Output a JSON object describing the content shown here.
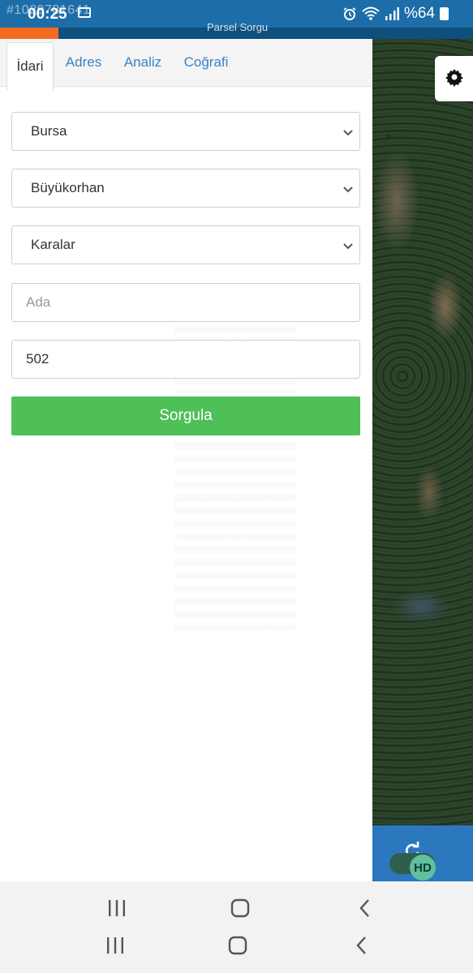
{
  "status_bar": {
    "watermark_id": "#1029781641",
    "time": "00:25",
    "battery": "%64",
    "icons": [
      "image-icon",
      "alarm-icon",
      "wifi-icon",
      "signal-icon",
      "battery-icon"
    ]
  },
  "app": {
    "accent_color": "#f26b21",
    "header_color": "#0f4f7d",
    "title": "Parsel Sorgu"
  },
  "tabs": [
    {
      "label": "İdari",
      "active": true
    },
    {
      "label": "Adres",
      "active": false
    },
    {
      "label": "Analiz",
      "active": false
    },
    {
      "label": "Coğrafi",
      "active": false
    }
  ],
  "form": {
    "province": {
      "value": "Bursa"
    },
    "district": {
      "value": "Büyükorhan"
    },
    "neighborhood": {
      "value": "Karalar"
    },
    "block": {
      "placeholder": "Ada",
      "value": ""
    },
    "parcel": {
      "value": "502"
    },
    "submit_label": "Sorgula",
    "submit_color": "#4fbf57"
  },
  "map": {
    "hd_label": "HD",
    "icons": [
      "gear-icon",
      "refresh-icon"
    ]
  },
  "nav": {
    "icons": [
      "recent-apps-icon",
      "home-icon",
      "back-icon"
    ]
  }
}
